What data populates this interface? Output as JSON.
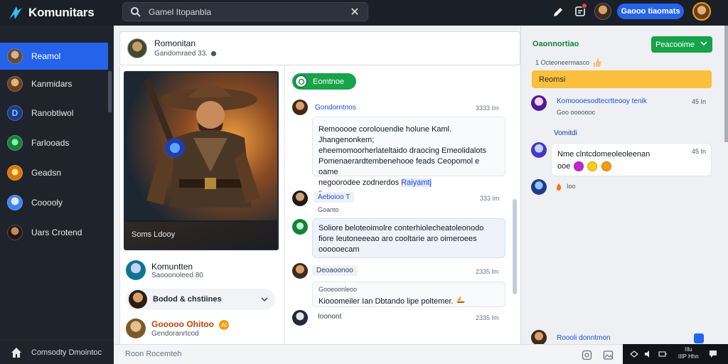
{
  "app": {
    "title": "Komunitars"
  },
  "search": {
    "value": "Gamel Itopanbla",
    "clear_glyph": "✕"
  },
  "topbar": {
    "primary_button": "Gaooo tiaomats"
  },
  "sidebar": {
    "items": [
      {
        "label": "Reamol",
        "active": true,
        "icon_color": "#8a6f5a"
      },
      {
        "label": "Kanmidars",
        "active": false,
        "icon_color": "#b87d4b"
      },
      {
        "label": "Ranobtiwol",
        "active": false,
        "icon_color": "#2563eb"
      },
      {
        "label": "Farlooads",
        "active": false,
        "icon_color": "#16a34a"
      },
      {
        "label": "Geadsn",
        "active": false,
        "icon_color": "#f59e0b"
      },
      {
        "label": "Cooooly",
        "active": false,
        "icon_color": "#93c5fd"
      },
      {
        "label": "Uars Crotend",
        "active": false,
        "icon_color": "#7c4a32"
      }
    ],
    "footer_label": "Comsodty Dmointoc"
  },
  "feed": {
    "author": "Romonitan",
    "subline": "Gandomraed 33."
  },
  "left": {
    "hero_caption": "Soms Ldooy",
    "profile_name": "Komuntten",
    "profile_sub": "Saooonoleed 80",
    "pill_label": "Bodod & chstiines",
    "orange_name": "Gooooo Ohitoo",
    "orange_badge": "Al",
    "orange_sub": "Gendoranrtcod"
  },
  "comments": {
    "pill_label": "Eomtnoe",
    "items": [
      {
        "name": "Gondorntnos",
        "time": "3333 Im",
        "lines": [
          "Remooooe corolouendie holune Kaml. Jhangenonkem;",
          "eheemomoorherlateltaido draocing Emeolidalots",
          "Pomenaerardtembenehooe feads Ceopomol e oame",
          "negoorodee zodnerdos"
        ],
        "link": "Raiyamtj",
        "foot": "Foooonor."
      },
      {
        "name": "Aeboioo T",
        "sub": "Goanto",
        "time": "333 Im",
        "lines": [
          "Soliore beloteoimolre conterhiolecheatoleonodo",
          "fiore Ieutoneeeao aro cooltarie aro oimeroees",
          "oooooecam"
        ]
      },
      {
        "name": "Deoaoonoo",
        "time": "2335 Im",
        "bubble_top": "Gooeoonleoo",
        "text": "Kiooomeiler Ian Dbtando lipe poltemer."
      },
      {
        "name": "Ioonont",
        "time": "2335 Im"
      }
    ]
  },
  "right": {
    "title": "Oaonnortiao",
    "button": "Peacooime",
    "sub": "1 Octeoneermasco",
    "banner": "Reomsi",
    "item1": {
      "name": "Komoooesodtecrtteooy tenik",
      "time": "45 In",
      "sub": "Goo ooooooc"
    },
    "section": "Vomitdi",
    "item2": {
      "time": "45 In",
      "line1": "Nme clntcdomeoleoleenan",
      "line2": "ooe"
    },
    "item3": {
      "text": "Ioo"
    },
    "footer": {
      "name": "Roooli donntmon"
    }
  },
  "bottom": {
    "placeholder": "Roon Rocemteh"
  },
  "taskbar": {
    "time": "IIlu",
    "date": "IIIP Hhn"
  }
}
